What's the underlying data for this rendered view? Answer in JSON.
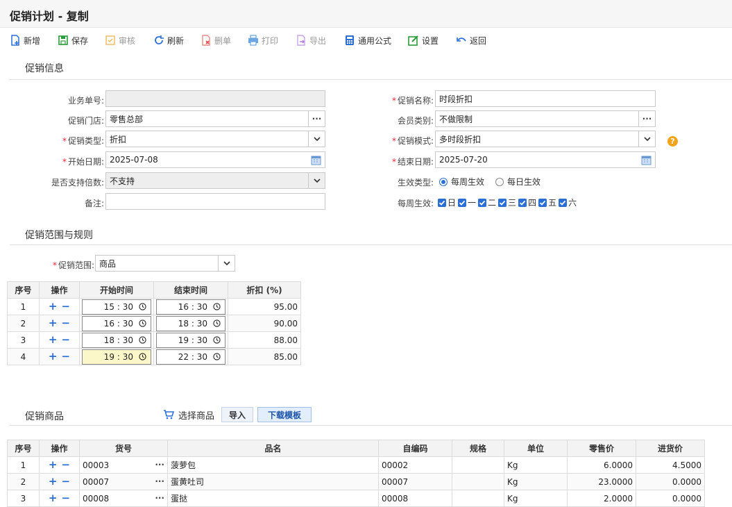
{
  "title": "促销计划 - 复制",
  "toolbar": {
    "add": "新增",
    "save": "保存",
    "audit": "审核",
    "refresh": "刷新",
    "delete": "删单",
    "print": "打印",
    "export": "导出",
    "formula": "通用公式",
    "settings": "设置",
    "back": "返回"
  },
  "info": {
    "section_title": "促销信息",
    "doc_no_label": "业务单号:",
    "doc_no_value": "",
    "store_label": "促销门店:",
    "store_value": "零售总部",
    "type_label": "促销类型:",
    "type_value": "折扣",
    "start_label": "开始日期:",
    "start_value": "2025-07-08",
    "multiple_label": "是否支持倍数:",
    "multiple_value": "不支持",
    "remark_label": "备注:",
    "remark_value": "",
    "name_label": "促销名称:",
    "name_value": "时段折扣",
    "member_label": "会员类别:",
    "member_value": "不做限制",
    "mode_label": "促销模式:",
    "mode_value": "多时段折扣",
    "end_label": "结束日期:",
    "end_value": "2025-07-20",
    "effect_label": "生效类型:",
    "effect_weekly": "每周生效",
    "effect_daily": "每日生效",
    "weekly_label": "每周生效:",
    "weekdays": [
      "日",
      "一",
      "二",
      "三",
      "四",
      "五",
      "六"
    ]
  },
  "rules": {
    "section_title": "促销范围与规则",
    "scope_label": "促销范围:",
    "scope_value": "商品",
    "headers": [
      "序号",
      "操作",
      "开始时间",
      "结束时间",
      "折扣 (%)"
    ],
    "rows": [
      {
        "idx": "1",
        "start": "15 : 30",
        "end": "16 : 30",
        "discount": "95.00"
      },
      {
        "idx": "2",
        "start": "16 : 30",
        "end": "18 : 30",
        "discount": "90.00"
      },
      {
        "idx": "3",
        "start": "18 : 30",
        "end": "19 : 30",
        "discount": "88.00"
      },
      {
        "idx": "4",
        "start": "19 : 30",
        "end": "22 : 30",
        "discount": "85.00"
      }
    ]
  },
  "goods": {
    "section_title": "促销商品",
    "select_label": "选择商品",
    "import_label": "导入",
    "template_label": "下载模板",
    "headers": [
      "序号",
      "操作",
      "货号",
      "品名",
      "自编码",
      "规格",
      "单位",
      "零售价",
      "进货价"
    ],
    "rows": [
      {
        "idx": "1",
        "code": "00003",
        "name": "菠萝包",
        "own_code": "00002",
        "spec": "",
        "unit": "Kg",
        "retail": "6.0000",
        "cost": "4.5000"
      },
      {
        "idx": "2",
        "code": "00007",
        "name": "蛋黄吐司",
        "own_code": "00007",
        "spec": "",
        "unit": "Kg",
        "retail": "23.0000",
        "cost": "0.0000"
      },
      {
        "idx": "3",
        "code": "00008",
        "name": "蛋挞",
        "own_code": "00008",
        "spec": "",
        "unit": "Kg",
        "retail": "2.0000",
        "cost": "0.0000"
      }
    ]
  },
  "colors": {
    "accent": "#2a6fd6",
    "required": "#e23333",
    "help": "#f2a51a",
    "highlight": "#fbf7c8"
  }
}
